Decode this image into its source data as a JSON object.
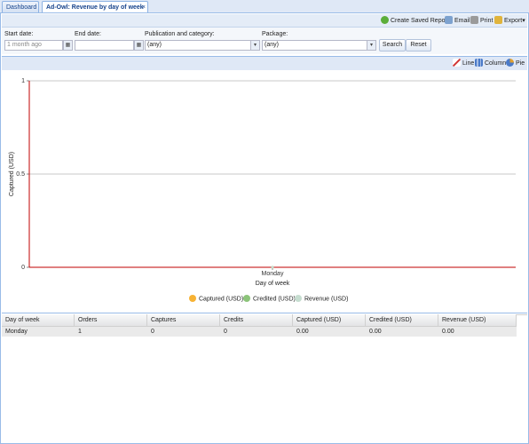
{
  "tabs": [
    {
      "label": "Dashboard"
    },
    {
      "label": "Ad-Owl: Revenue by day of week",
      "close": "×"
    }
  ],
  "toolbar": {
    "create_saved_report": "Create Saved Report",
    "email": "Email",
    "print": "Print",
    "export": "Export"
  },
  "filters": {
    "start_date_label": "Start date:",
    "start_date_value": "1 month ago",
    "end_date_label": "End date:",
    "end_date_value": "",
    "publication_label": "Publication and category:",
    "publication_value": "(any)",
    "package_label": "Package:",
    "package_value": "(any)",
    "search": "Search",
    "reset": "Reset"
  },
  "chart_controls": {
    "line": "Line",
    "column": "Column",
    "pie": "Pie"
  },
  "colors": {
    "captured": "#f7b234",
    "credited": "#8cc47a",
    "revenue": "#c6ddd0",
    "axis": "#c00000"
  },
  "chart_data": {
    "type": "line",
    "categories": [
      "Monday"
    ],
    "series": [
      {
        "name": "Captured (USD)",
        "values": [
          0
        ]
      },
      {
        "name": "Credited (USD)",
        "values": [
          0
        ]
      },
      {
        "name": "Revenue (USD)",
        "values": [
          0
        ]
      }
    ],
    "xlabel": "Day of week",
    "ylabel": "Captured (USD)",
    "ylim": [
      0,
      1
    ],
    "yticks": [
      "0",
      "0.5",
      "1"
    ],
    "grid": true,
    "legend": "bottom"
  },
  "grid": {
    "columns": [
      "Day of week",
      "Orders",
      "Captures",
      "Credits",
      "Captured (USD)",
      "Credited (USD)",
      "Revenue (USD)"
    ],
    "rows": [
      [
        "Monday",
        "1",
        "0",
        "0",
        "0.00",
        "0.00",
        "0.00"
      ]
    ]
  }
}
